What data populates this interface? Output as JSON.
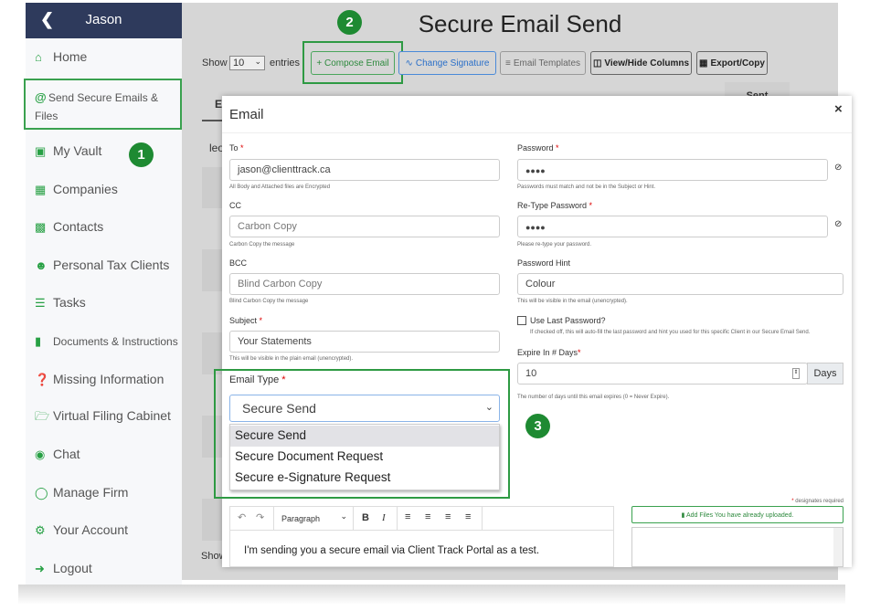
{
  "sidebar": {
    "user": "Jason",
    "back_icon": "chevron-left-icon",
    "items": [
      {
        "label": "Home",
        "icon": "home-icon"
      },
      {
        "label": "Send Secure Emails & Files",
        "icon": "at-icon"
      },
      {
        "label": "My Vault",
        "icon": "lock-icon"
      },
      {
        "label": "Companies",
        "icon": "building-icon"
      },
      {
        "label": "Contacts",
        "icon": "contact-book-icon"
      },
      {
        "label": "Personal Tax Clients",
        "icon": "users-icon"
      },
      {
        "label": "Tasks",
        "icon": "tasks-icon"
      },
      {
        "label": "Documents & Instructions",
        "icon": "file-icon"
      },
      {
        "label": "Missing Information",
        "icon": "question-circle-icon"
      },
      {
        "label": "Virtual Filing Cabinet",
        "icon": "folder-open-icon"
      },
      {
        "label": "Chat",
        "icon": "comments-icon"
      },
      {
        "label": "Manage Firm",
        "icon": "globe-icon"
      },
      {
        "label": "Your Account",
        "icon": "cogs-icon"
      },
      {
        "label": "Logout",
        "icon": "sign-out-icon"
      }
    ]
  },
  "page": {
    "title": "Secure Email Send",
    "show": "Show",
    "entries_value": "10",
    "entries": "entries",
    "buttons": {
      "compose": "+ Compose Email",
      "signature": "Change Signature",
      "templates": "Email Templates",
      "columns": "View/Hide Columns",
      "export": "Export/Copy"
    },
    "table": {
      "col_first": "E",
      "col_sent": "Sent",
      "first_cell": "leo",
      "footer": "Show"
    }
  },
  "badges": [
    "1",
    "2",
    "3"
  ],
  "accent": "#1e8a32",
  "modal": {
    "title": "Email",
    "close": "×",
    "to": {
      "label": "To",
      "value": "jason@clienttrack.ca",
      "help": "All Body and Attached files are Encrypted"
    },
    "cc": {
      "label": "CC",
      "placeholder": "Carbon Copy",
      "help": "Carbon Copy the message"
    },
    "bcc": {
      "label": "BCC",
      "placeholder": "Blind Carbon Copy",
      "help": "Blind Carbon Copy the message"
    },
    "subject": {
      "label": "Subject",
      "value": "Your Statements",
      "help": "This will be visible in the plain email (unencrypted)."
    },
    "email_type": {
      "label": "Email Type",
      "value": "Secure Send",
      "options": [
        "Secure Send",
        "Secure Document Request",
        "Secure e-Signature Request"
      ]
    },
    "password": {
      "label": "Password",
      "value": "●●●●",
      "help": "Passwords must match and not be in the Subject or Hint."
    },
    "retype": {
      "label": "Re-Type Password",
      "value": "●●●●",
      "help": "Please re-type your password."
    },
    "hint": {
      "label": "Password Hint",
      "value": "Colour",
      "help": "This will be visible in the email (unencrypted)."
    },
    "use_last": {
      "label": "Use Last Password?",
      "checked": false,
      "help": "If checked off, this will auto-fill the last password and hint you used for this specific Client in our Secure Email Send."
    },
    "expire": {
      "label": "Expire In # Days",
      "value": "10",
      "addon": "Days",
      "help": "The number of days until this email expires (0 = Never Expire)."
    },
    "required_note": "designates required",
    "editor": {
      "format": "Paragraph",
      "body": "I'm sending you a secure email via Client Track Portal as a test."
    },
    "add_files": "Add Files You have already uploaded."
  }
}
